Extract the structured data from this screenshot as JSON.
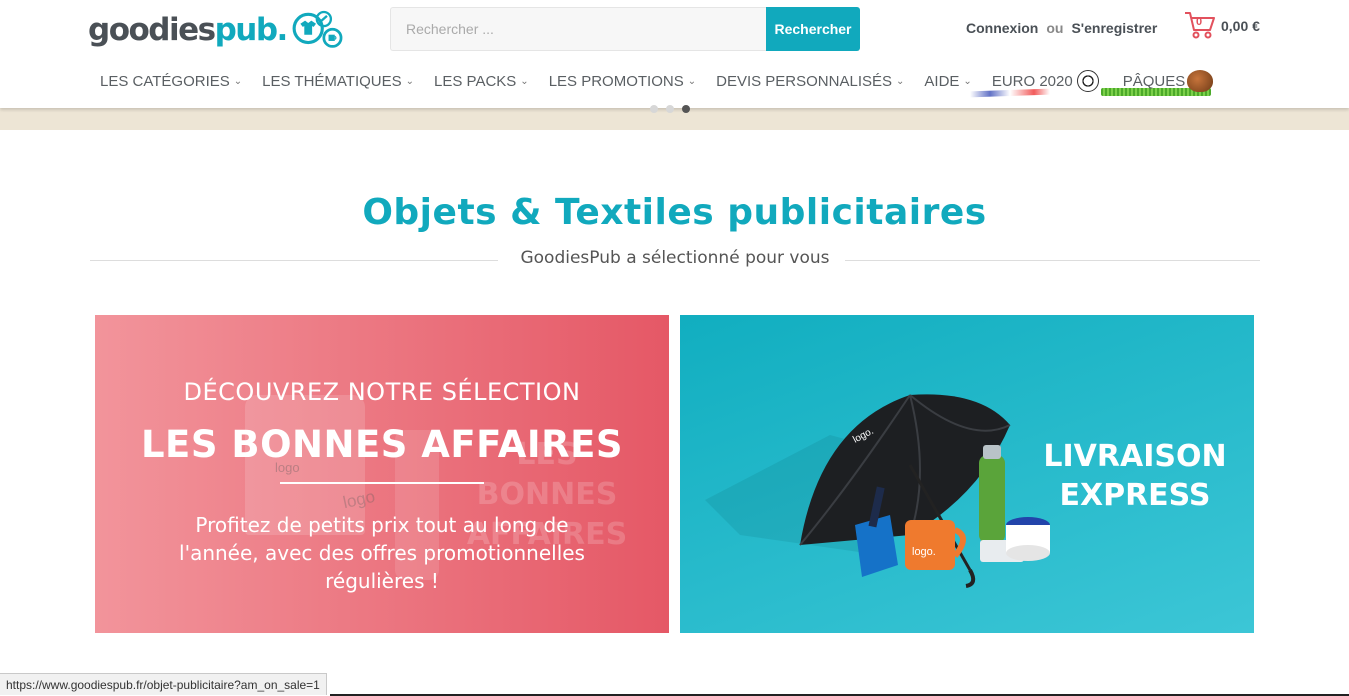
{
  "header": {
    "logo_text_main": "goodies",
    "logo_text_accent": "pub.",
    "search_placeholder": "Rechercher ...",
    "search_button": "Rechercher",
    "login": "Connexion",
    "or": "ou",
    "register": "S'enregistrer",
    "cart_count": "0",
    "cart_total": "0,00 €"
  },
  "nav": {
    "items": [
      {
        "label": "LES CATÉGORIES"
      },
      {
        "label": "LES THÉMATIQUES"
      },
      {
        "label": "LES PACKS"
      },
      {
        "label": "LES PROMOTIONS"
      },
      {
        "label": "DEVIS PERSONNALISÉS"
      },
      {
        "label": "AIDE"
      },
      {
        "label": "EURO 2020"
      },
      {
        "label": "PÂQUES"
      }
    ]
  },
  "section": {
    "title": "Objets & Textiles publicitaires",
    "subtitle": "GoodiesPub a sélectionné pour vous"
  },
  "cards": {
    "left": {
      "kicker": "DÉCOUVREZ NOTRE SÉLECTION",
      "title": "LES BONNES AFFAIRES",
      "ghost_title": "LES BONNES AFFAIRES",
      "product_logo": "logo",
      "text": "Profitez de petits prix tout au long de l'année, avec des offres promotionnelles régulières !"
    },
    "right": {
      "title": "LIVRAISON EXPRESS",
      "product_logo": "logo.",
      "product_logo_alt": "votre logo"
    }
  },
  "status_bar": {
    "url": "https://www.goodiespub.fr/objet-publicitaire?am_on_sale=1"
  },
  "colors": {
    "brand": "#11a9bd",
    "text_dark": "#4a5056",
    "promo_pink": "#e55866",
    "cart_red": "#e2515d"
  },
  "icons": [
    "goodiespub-logo-icon",
    "cart-icon",
    "chevron-down-icon",
    "football-icon",
    "easter-egg-icon"
  ]
}
